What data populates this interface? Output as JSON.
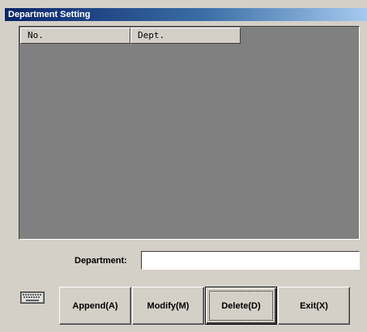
{
  "window": {
    "title": "Department Setting"
  },
  "list": {
    "columns": [
      "No.",
      "Dept."
    ],
    "rows": []
  },
  "form": {
    "department_label": "Department:",
    "department_value": ""
  },
  "icons": {
    "keyboard": "keyboard-icon"
  },
  "buttons": {
    "append": "Append(A)",
    "modify": "Modify(M)",
    "delete": "Delete(D)",
    "exit": "Exit(X)"
  },
  "focused_button": "delete"
}
